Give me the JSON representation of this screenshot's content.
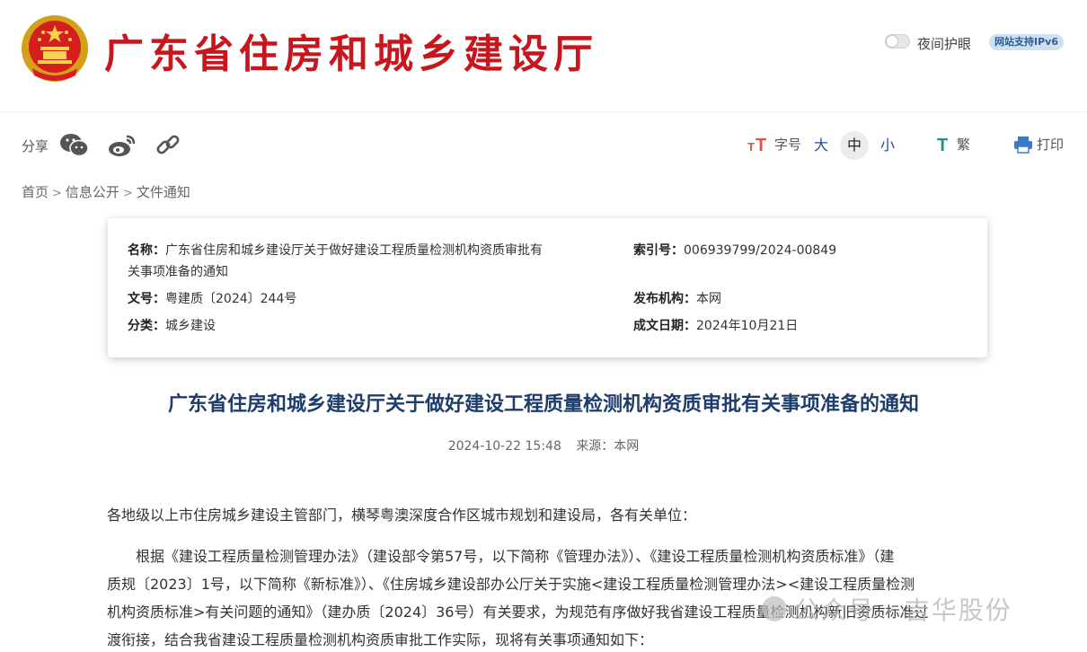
{
  "header": {
    "site_title": "广东省住房和城乡建设厅",
    "night_mode_label": "夜间护眼",
    "ipv6_badge": "网站支持IPv6"
  },
  "toolbar": {
    "share_label": "分享",
    "share_icons": [
      "wechat-icon",
      "weibo-icon",
      "link-icon"
    ],
    "font_size_label": "字号",
    "font_sizes": [
      "大",
      "中",
      "小"
    ],
    "active_font_size": "中",
    "traditional_label": "繁",
    "print_label": "打印"
  },
  "breadcrumb": {
    "items": [
      "首页",
      "信息公开",
      "文件通知"
    ],
    "separator": ">"
  },
  "info": {
    "name_label": "名称：",
    "name_line1": "广东省住房和城乡建设厅关于做好建设工程质量检测机构资质审批有",
    "name_line2": "关事项准备的通知",
    "index_label": "索引号：",
    "index_value": "006939799/2024-00849",
    "doc_no_label": "文号：",
    "doc_no_value": "粤建质〔2024〕244号",
    "publisher_label": "发布机构：",
    "publisher_value": "本网",
    "category_label": "分类：",
    "category_value": "城乡建设",
    "date_label": "成文日期：",
    "date_value": "2024年10月21日"
  },
  "article": {
    "title": "广东省住房和城乡建设厅关于做好建设工程质量检测机构资质审批有关事项准备的通知",
    "date": "2024-10-22  15:48",
    "source": "来源：本网",
    "salutation": "各地级以上市住房城乡建设主管部门，横琴粤澳深度合作区城市规划和建设局，各有关单位：",
    "body_lines": [
      "根据《建设工程质量检测管理办法》（建设部令第57号，以下简称《管理办法》）、《建设工程质量检测机构资质标准》（建",
      "质规〔2023〕1号，以下简称《新标准》）、《住房城乡建设部办公厅关于实施<建设工程质量检测管理办法><建设工程质量检测",
      "机构资质标准>有关问题的通知》（建办质〔2024〕36号）有关要求，为规范有序做好我省建设工程质量检测机构新旧资质标准过",
      "渡衔接，结合我省建设工程质量检测机构资质审批工作实际，现将有关事项通知如下："
    ]
  },
  "watermark": {
    "text": "公众号 · 吉华股份"
  },
  "colors": {
    "brand_red": "#c8161d",
    "title_blue": "#1f3d6b",
    "link_blue": "#1f4e9a"
  }
}
